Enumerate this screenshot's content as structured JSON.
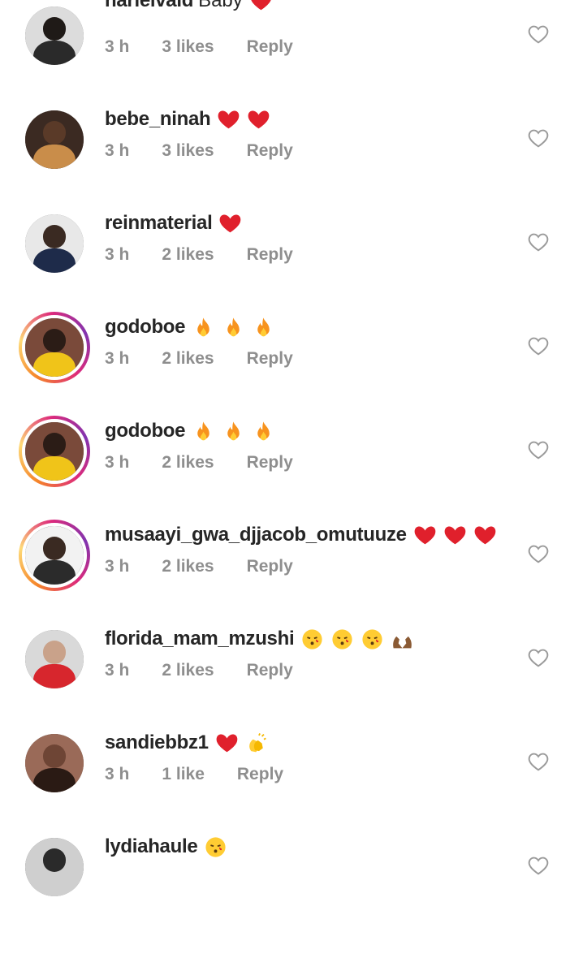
{
  "comments": [
    {
      "username": "narielvaid",
      "message": "Baby",
      "emojis": [
        "heart"
      ],
      "time": "3 h",
      "likes": "3 likes",
      "reply": "Reply",
      "avatar": {
        "bg": "#dcdcdc",
        "skin": "#1f1a17",
        "shirt": "#2a2a2a",
        "story_ring": false
      }
    },
    {
      "username": "bebe_ninah",
      "message": "",
      "emojis": [
        "heart",
        "heart"
      ],
      "time": "3 h",
      "likes": "3 likes",
      "reply": "Reply",
      "avatar": {
        "bg": "#3b2a22",
        "skin": "#5a3a28",
        "shirt": "#c98d4a",
        "story_ring": false
      }
    },
    {
      "username": "reinmaterial",
      "message": "",
      "emojis": [
        "heart"
      ],
      "time": "3 h",
      "likes": "2 likes",
      "reply": "Reply",
      "avatar": {
        "bg": "#e8e8e8",
        "skin": "#3a2a22",
        "shirt": "#1e2b4a",
        "story_ring": false
      }
    },
    {
      "username": "godoboe",
      "message": "",
      "emojis": [
        "fire",
        "fire",
        "fire"
      ],
      "time": "3 h",
      "likes": "2 likes",
      "reply": "Reply",
      "avatar": {
        "bg": "#7a4a3a",
        "skin": "#2b1c16",
        "shirt": "#f0c419",
        "story_ring": true
      }
    },
    {
      "username": "godoboe",
      "message": "",
      "emojis": [
        "fire",
        "fire",
        "fire"
      ],
      "time": "3 h",
      "likes": "2 likes",
      "reply": "Reply",
      "avatar": {
        "bg": "#7a4a3a",
        "skin": "#2b1c16",
        "shirt": "#f0c419",
        "story_ring": true
      }
    },
    {
      "username": "musaayi_gwa_djjacob_omutuuze",
      "message": "",
      "emojis": [
        "heart",
        "heart",
        "heart"
      ],
      "time": "3 h",
      "likes": "2 likes",
      "reply": "Reply",
      "avatar": {
        "bg": "#f2f2f2",
        "skin": "#3a2a22",
        "shirt": "#2b2b2b",
        "story_ring": true
      }
    },
    {
      "username": "florida_mam_mzushi",
      "message": "",
      "emojis": [
        "kiss",
        "kiss",
        "kiss",
        "hands"
      ],
      "time": "3 h",
      "likes": "2 likes",
      "reply": "Reply",
      "avatar": {
        "bg": "#d9d9d9",
        "skin": "#c9a28a",
        "shirt": "#d7262d",
        "story_ring": false
      }
    },
    {
      "username": "sandiebbz1",
      "message": "",
      "emojis": [
        "heart",
        "clap"
      ],
      "time": "3 h",
      "likes": "1 like",
      "reply": "Reply",
      "avatar": {
        "bg": "#9a6a58",
        "skin": "#6e4535",
        "shirt": "#2a1a14",
        "story_ring": false
      }
    },
    {
      "username": "lydiahaule",
      "message": "",
      "emojis": [
        "kiss"
      ],
      "time": "",
      "likes": "",
      "reply": "",
      "avatar": {
        "bg": "#cfcfcf",
        "skin": "#2a2a2a",
        "shirt": "#cfcfcf",
        "story_ring": false
      }
    }
  ],
  "colors": {
    "text": "#262626",
    "meta": "#8e8e8e",
    "heart": "#e0202c",
    "like_icon": "#9a9a9a"
  },
  "icons": {
    "like": "heart-outline-icon"
  }
}
